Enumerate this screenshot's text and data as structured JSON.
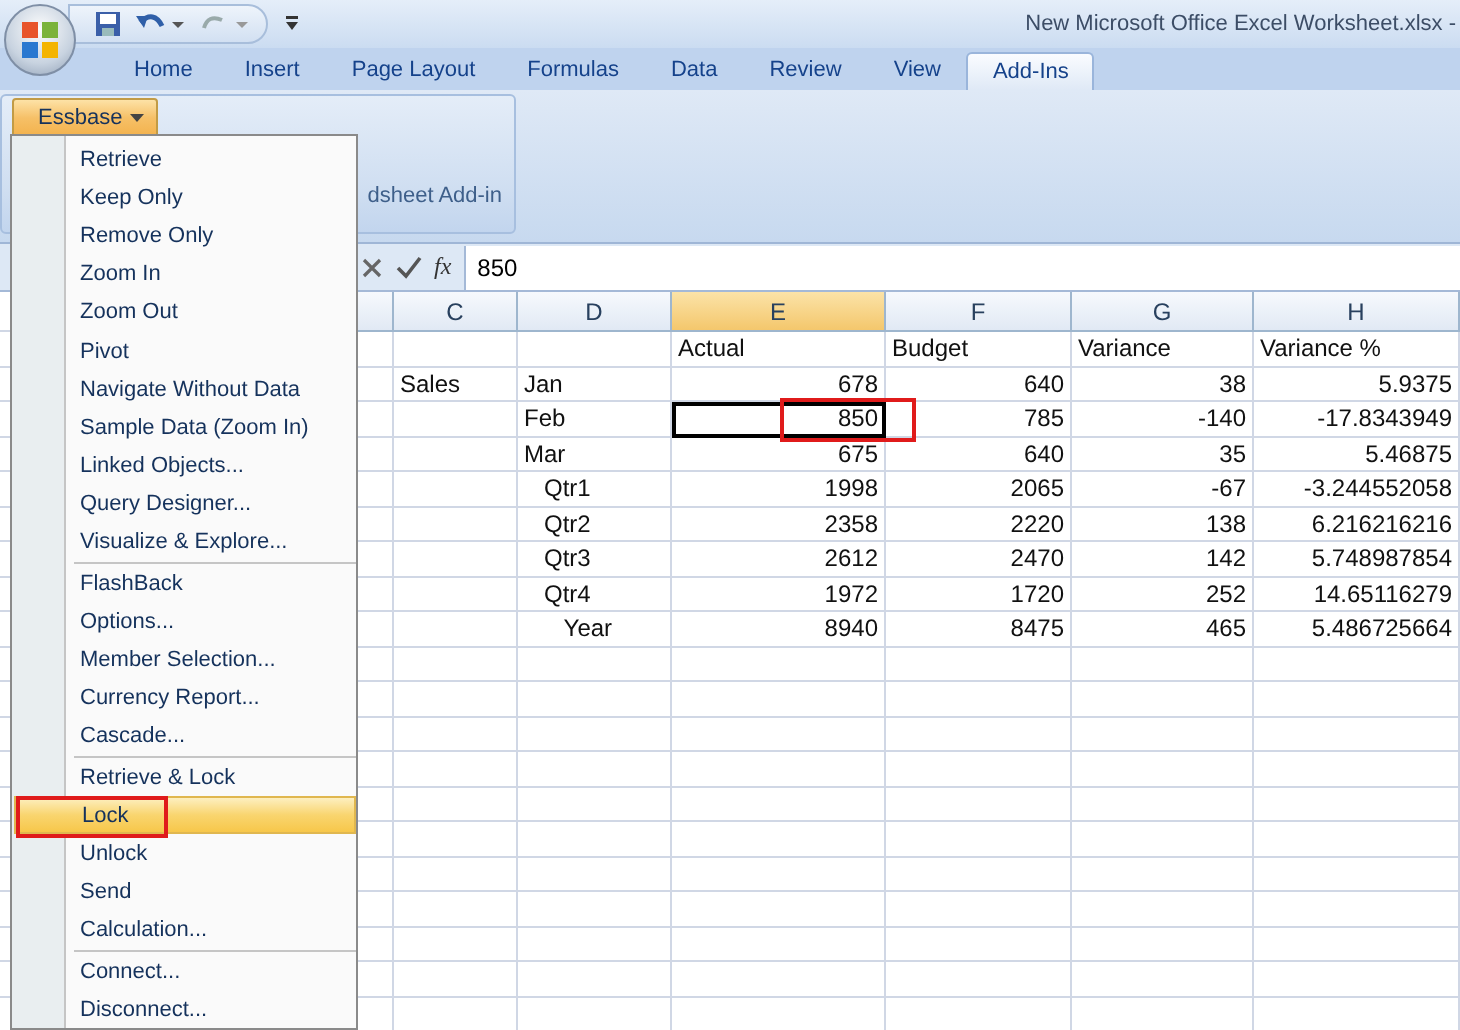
{
  "title_bar": {
    "title": "New Microsoft Office Excel Worksheet.xlsx -"
  },
  "ribbon_tabs": [
    {
      "label": "Home",
      "selected": false
    },
    {
      "label": "Insert",
      "selected": false
    },
    {
      "label": "Page Layout",
      "selected": false
    },
    {
      "label": "Formulas",
      "selected": false
    },
    {
      "label": "Data",
      "selected": false
    },
    {
      "label": "Review",
      "selected": false
    },
    {
      "label": "View",
      "selected": false
    },
    {
      "label": "Add-Ins",
      "selected": true
    }
  ],
  "ribbon": {
    "menu_button": "Essbase",
    "group_label": "dsheet Add-in"
  },
  "formula_bar": {
    "function_label": "fx",
    "value": "850"
  },
  "columns": [
    {
      "label": "C",
      "selected": false
    },
    {
      "label": "D",
      "selected": false
    },
    {
      "label": "E",
      "selected": true
    },
    {
      "label": "F",
      "selected": false
    },
    {
      "label": "G",
      "selected": false
    },
    {
      "label": "H",
      "selected": false
    }
  ],
  "rows": [
    {
      "kind": "header",
      "cells": [
        {
          "text": "",
          "selected": false,
          "outlined": false
        },
        {
          "text": "",
          "selected": false,
          "outlined": false
        },
        {
          "text": "Actual",
          "selected": false,
          "outlined": false
        },
        {
          "text": "Budget",
          "selected": false,
          "outlined": false
        },
        {
          "text": "Variance",
          "selected": false,
          "outlined": false
        },
        {
          "text": "Variance %",
          "selected": false,
          "outlined": false
        }
      ]
    },
    {
      "kind": "data",
      "cells": [
        {
          "text": "Sales",
          "selected": false,
          "outlined": false
        },
        {
          "text": "Jan",
          "selected": false,
          "outlined": false
        },
        {
          "text": "678",
          "selected": false,
          "outlined": false
        },
        {
          "text": "640",
          "selected": false,
          "outlined": false
        },
        {
          "text": "38",
          "selected": false,
          "outlined": false
        },
        {
          "text": "5.9375",
          "selected": false,
          "outlined": false
        }
      ]
    },
    {
      "kind": "data",
      "cells": [
        {
          "text": "",
          "selected": false,
          "outlined": false
        },
        {
          "text": "Feb",
          "selected": false,
          "outlined": false
        },
        {
          "text": "850",
          "selected": true,
          "outlined": true
        },
        {
          "text": "785",
          "selected": false,
          "outlined": false
        },
        {
          "text": "-140",
          "selected": false,
          "outlined": false
        },
        {
          "text": "-17.8343949",
          "selected": false,
          "outlined": false
        }
      ]
    },
    {
      "kind": "data",
      "cells": [
        {
          "text": "",
          "selected": false,
          "outlined": false
        },
        {
          "text": "Mar",
          "selected": false,
          "outlined": false
        },
        {
          "text": "675",
          "selected": false,
          "outlined": false
        },
        {
          "text": "640",
          "selected": false,
          "outlined": false
        },
        {
          "text": "35",
          "selected": false,
          "outlined": false
        },
        {
          "text": "5.46875",
          "selected": false,
          "outlined": false
        }
      ]
    },
    {
      "kind": "data",
      "cells": [
        {
          "text": "",
          "selected": false,
          "outlined": false
        },
        {
          "text": "   Qtr1",
          "selected": false,
          "outlined": false
        },
        {
          "text": "1998",
          "selected": false,
          "outlined": false
        },
        {
          "text": "2065",
          "selected": false,
          "outlined": false
        },
        {
          "text": "-67",
          "selected": false,
          "outlined": false
        },
        {
          "text": "-3.244552058",
          "selected": false,
          "outlined": false
        }
      ]
    },
    {
      "kind": "data",
      "cells": [
        {
          "text": "",
          "selected": false,
          "outlined": false
        },
        {
          "text": "   Qtr2",
          "selected": false,
          "outlined": false
        },
        {
          "text": "2358",
          "selected": false,
          "outlined": false
        },
        {
          "text": "2220",
          "selected": false,
          "outlined": false
        },
        {
          "text": "138",
          "selected": false,
          "outlined": false
        },
        {
          "text": "6.216216216",
          "selected": false,
          "outlined": false
        }
      ]
    },
    {
      "kind": "data",
      "cells": [
        {
          "text": "",
          "selected": false,
          "outlined": false
        },
        {
          "text": "   Qtr3",
          "selected": false,
          "outlined": false
        },
        {
          "text": "2612",
          "selected": false,
          "outlined": false
        },
        {
          "text": "2470",
          "selected": false,
          "outlined": false
        },
        {
          "text": "142",
          "selected": false,
          "outlined": false
        },
        {
          "text": "5.748987854",
          "selected": false,
          "outlined": false
        }
      ]
    },
    {
      "kind": "data",
      "cells": [
        {
          "text": "",
          "selected": false,
          "outlined": false
        },
        {
          "text": "   Qtr4",
          "selected": false,
          "outlined": false
        },
        {
          "text": "1972",
          "selected": false,
          "outlined": false
        },
        {
          "text": "1720",
          "selected": false,
          "outlined": false
        },
        {
          "text": "252",
          "selected": false,
          "outlined": false
        },
        {
          "text": "14.65116279",
          "selected": false,
          "outlined": false
        }
      ]
    },
    {
      "kind": "data",
      "cells": [
        {
          "text": "",
          "selected": false,
          "outlined": false
        },
        {
          "text": "      Year",
          "selected": false,
          "outlined": false
        },
        {
          "text": "8940",
          "selected": false,
          "outlined": false
        },
        {
          "text": "8475",
          "selected": false,
          "outlined": false
        },
        {
          "text": "465",
          "selected": false,
          "outlined": false
        },
        {
          "text": "5.486725664",
          "selected": false,
          "outlined": false
        }
      ]
    }
  ],
  "menu": {
    "sections": [
      [
        {
          "label": "Retrieve",
          "selected": false,
          "outlined": false
        },
        {
          "label": "Keep Only",
          "selected": false,
          "outlined": false
        },
        {
          "label": "Remove Only",
          "selected": false,
          "outlined": false
        },
        {
          "label": "Zoom In",
          "selected": false,
          "outlined": false
        },
        {
          "label": "Zoom Out",
          "selected": false,
          "outlined": false
        },
        {
          "label": "Pivot",
          "selected": false,
          "outlined": false
        },
        {
          "label": "Navigate Without Data",
          "selected": false,
          "outlined": false
        },
        {
          "label": "Sample Data (Zoom In)",
          "selected": false,
          "outlined": false
        },
        {
          "label": "Linked Objects...",
          "selected": false,
          "outlined": false
        },
        {
          "label": "Query Designer...",
          "selected": false,
          "outlined": false
        },
        {
          "label": "Visualize & Explore...",
          "selected": false,
          "outlined": false
        }
      ],
      [
        {
          "label": "FlashBack",
          "selected": false,
          "outlined": false
        },
        {
          "label": "Options...",
          "selected": false,
          "outlined": false
        },
        {
          "label": "Member Selection...",
          "selected": false,
          "outlined": false
        },
        {
          "label": "Currency Report...",
          "selected": false,
          "outlined": false
        },
        {
          "label": "Cascade...",
          "selected": false,
          "outlined": false
        }
      ],
      [
        {
          "label": "Retrieve & Lock",
          "selected": false,
          "outlined": false
        },
        {
          "label": "Lock",
          "selected": true,
          "outlined": true
        },
        {
          "label": "Unlock",
          "selected": false,
          "outlined": false
        },
        {
          "label": "Send",
          "selected": false,
          "outlined": false
        },
        {
          "label": "Calculation...",
          "selected": false,
          "outlined": false
        }
      ],
      [
        {
          "label": "Connect...",
          "selected": false,
          "outlined": false
        },
        {
          "label": "Disconnect...",
          "selected": false,
          "outlined": false
        }
      ]
    ]
  }
}
